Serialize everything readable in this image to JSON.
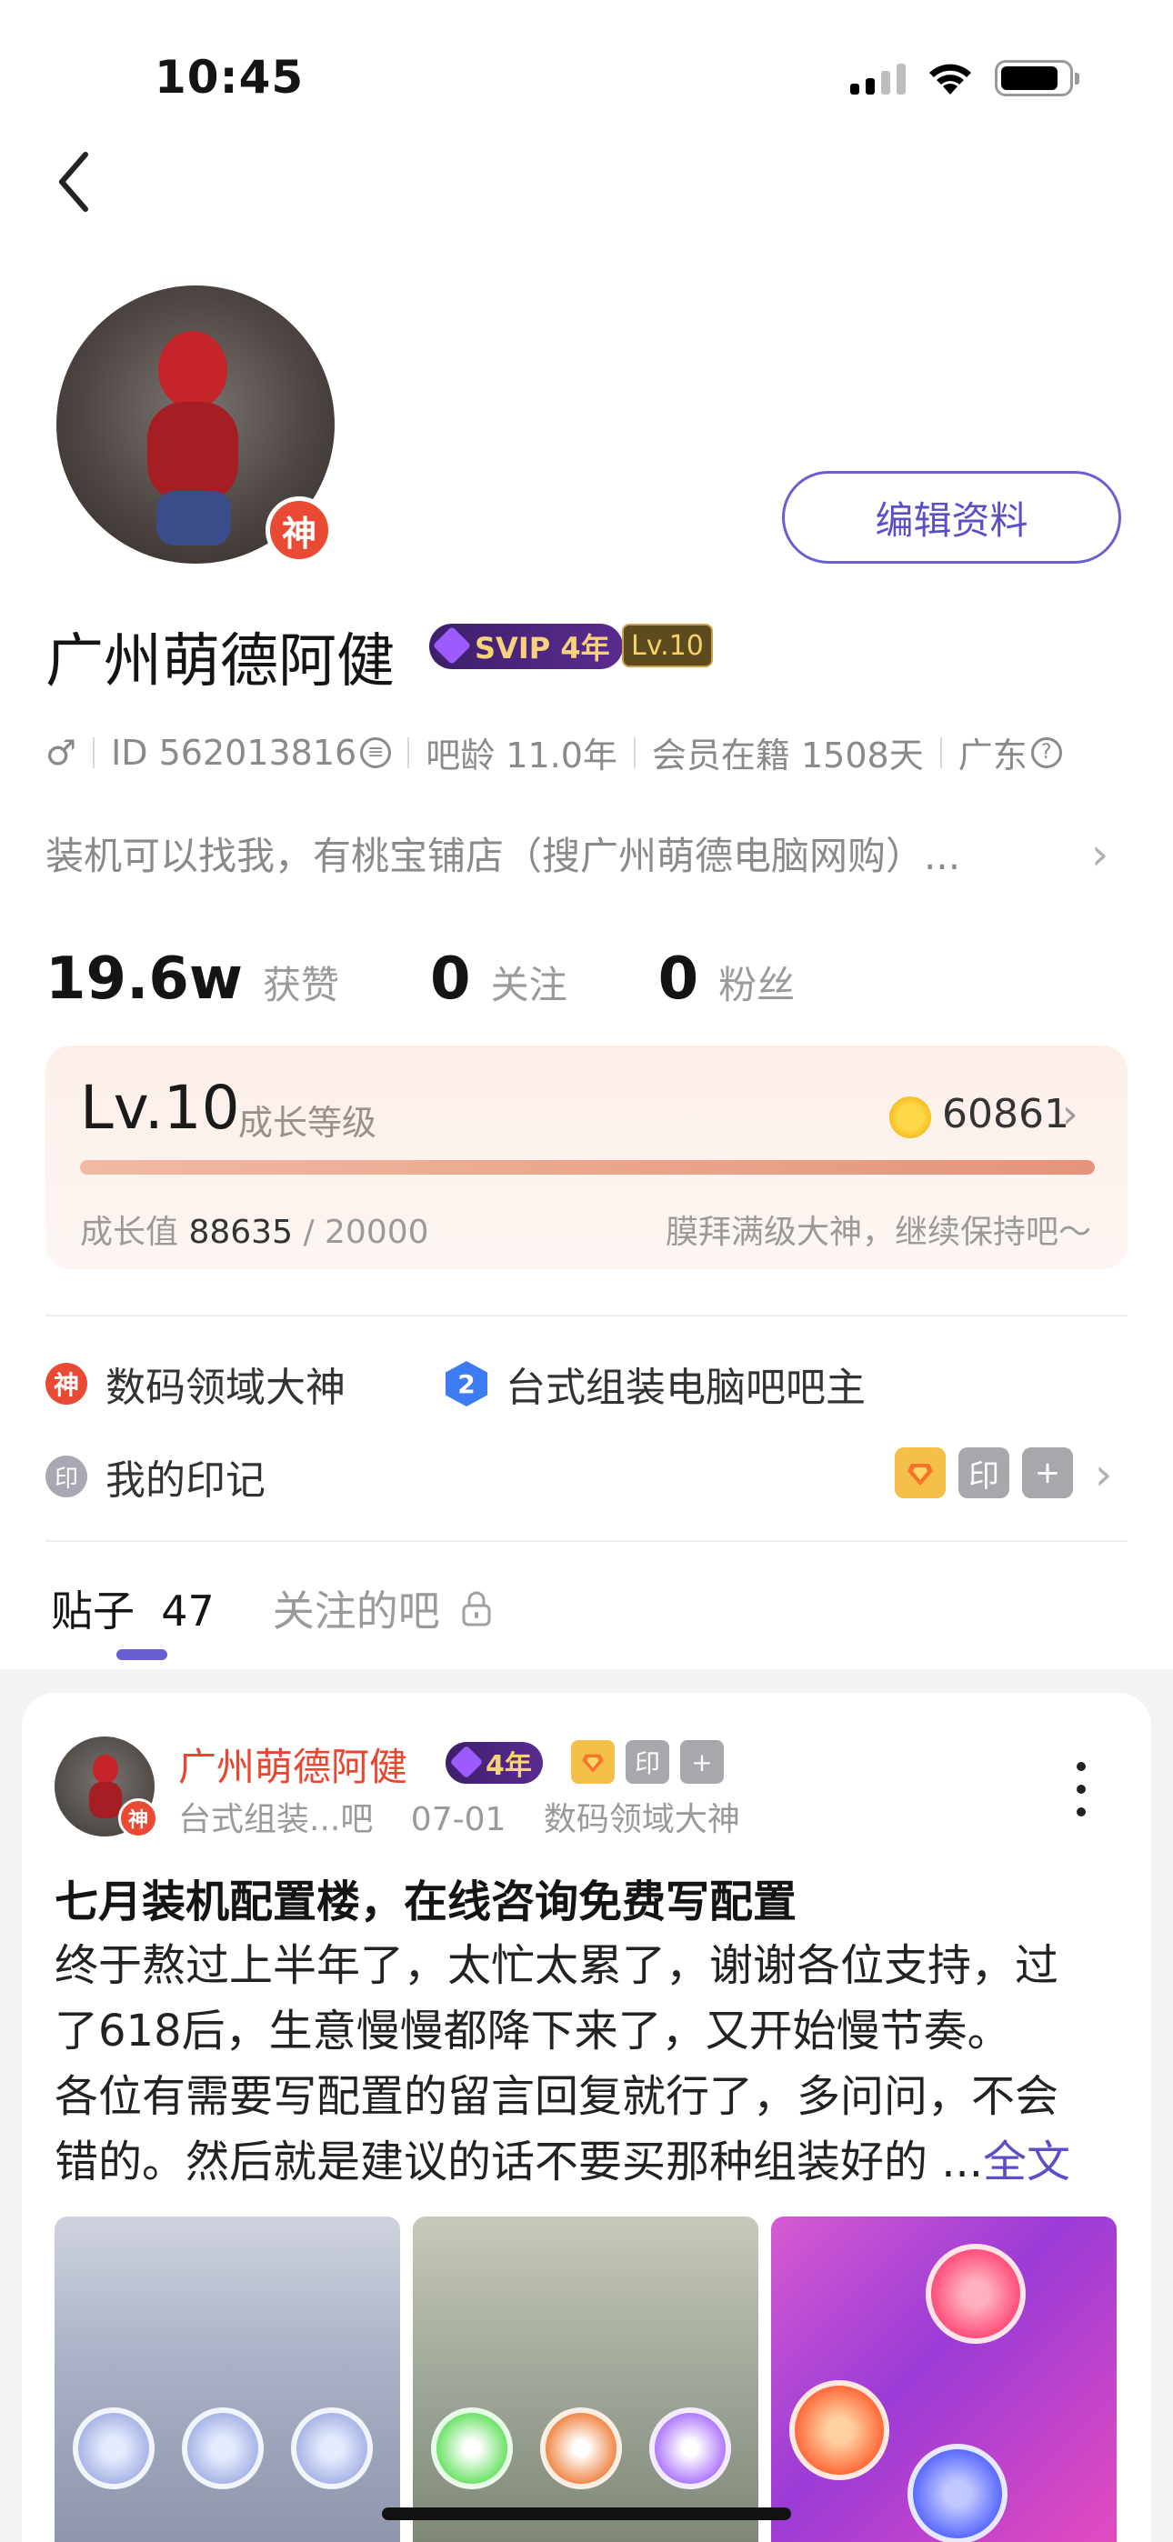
{
  "status_bar": {
    "time": "10:45"
  },
  "profile": {
    "name": "广州萌德阿健",
    "avatar_badge": "神",
    "svip_label": "SVIP 4年",
    "level_badge": "Lv.10",
    "edit_button": "编辑资料",
    "meta": {
      "gender_icon": "♂",
      "id": "ID 562013816",
      "bar_age": "吧龄 11.0年",
      "member": "会员在籍 1508天",
      "location": "广东"
    },
    "bio": "装机可以找我，有桃宝铺店（搜广州萌德电脑网购）..."
  },
  "stats": [
    {
      "num": "19.6w",
      "label": "获赞"
    },
    {
      "num": "0",
      "label": "关注"
    },
    {
      "num": "0",
      "label": "粉丝"
    }
  ],
  "level_card": {
    "level": "Lv.10",
    "level_label": "成长等级",
    "coins": "60861",
    "progress_fraction": 1.0,
    "growth_label": "成长值",
    "growth_value": "88635",
    "growth_max": "/ 20000",
    "message": "膜拜满级大神，继续保持吧～"
  },
  "honors": [
    {
      "icon_text": "神",
      "label": "数码领域大神",
      "color": "#e94a34"
    },
    {
      "icon_text": "2",
      "label": "台式组装电脑吧吧主",
      "color": "#3d7bf0"
    }
  ],
  "marks": {
    "icon_text": "印",
    "label": "我的印记",
    "badge_icons": [
      "medal-icon",
      "stamp-icon",
      "plus-icon"
    ],
    "badge_text": [
      "",
      "印",
      "+"
    ]
  },
  "tabs": [
    {
      "label": "贴子",
      "count": "47"
    },
    {
      "label": "关注的吧"
    }
  ],
  "post": {
    "author": "广州萌德阿健",
    "vip_label": "4年",
    "badge_text": [
      "",
      "印",
      "+"
    ],
    "forum": "台式组装...吧",
    "date": "07-01",
    "honor": "数码领域大神",
    "avatar_badge": "神",
    "title": "七月装机配置楼，在线咨询免费写配置",
    "lines": [
      "终于熬过上半年了，太忙太累了，谢谢各位支持，过",
      "了618后，生意慢慢都降下来了，又开始慢节奏。",
      "各位有需要写配置的留言回复就行了，多问问，不会",
      "错的。然后就是建议的话不要买那种组装好的 ..."
    ],
    "more_label": "全文"
  }
}
